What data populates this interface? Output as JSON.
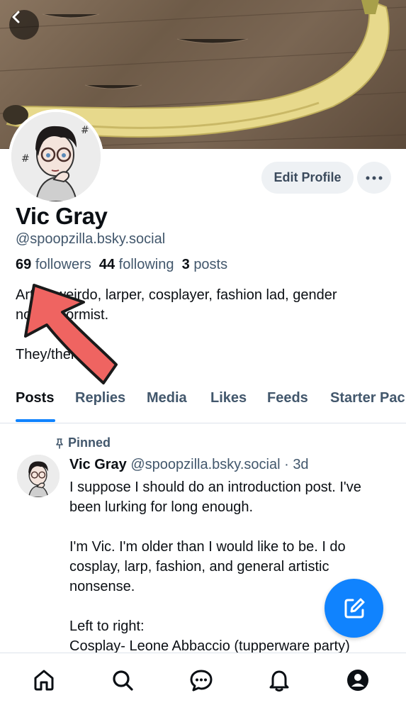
{
  "profile": {
    "display_name": "Vic Gray",
    "handle": "@spoopzilla.bsky.social",
    "followers_count": "69",
    "followers_label": "followers",
    "following_count": "44",
    "following_label": "following",
    "posts_count": "3",
    "posts_label": "posts",
    "bio": "Artist, weirdo, larper, cosplayer, fashion lad, gender nonconformist.\n\nThey/them",
    "edit_label": "Edit Profile"
  },
  "tabs": [
    "Posts",
    "Replies",
    "Media",
    "Likes",
    "Feeds",
    "Starter Packs"
  ],
  "post": {
    "pinned_label": "Pinned",
    "author": "Vic Gray",
    "handle": "@spoopzilla.bsky.social",
    "separator": "·",
    "time": "3d",
    "text": "I suppose I should do an introduction post. I've been lurking for long enough.\n\nI'm Vic. I'm older than I would like to be. I do cosplay, larp, fashion, and general artistic nonsense.\n\nLeft to right:\nCosplay- Leone Abbaccio (tupperware party)"
  },
  "icons": {
    "back": "chevron-left-icon",
    "more": "ellipsis-icon",
    "fab": "compose-icon",
    "nav": [
      "home-icon",
      "search-icon",
      "chat-icon",
      "bell-icon",
      "profile-icon"
    ]
  },
  "colors": {
    "accent": "#1083fe",
    "arrow": "#ef6461",
    "muted_text": "#42576c"
  }
}
